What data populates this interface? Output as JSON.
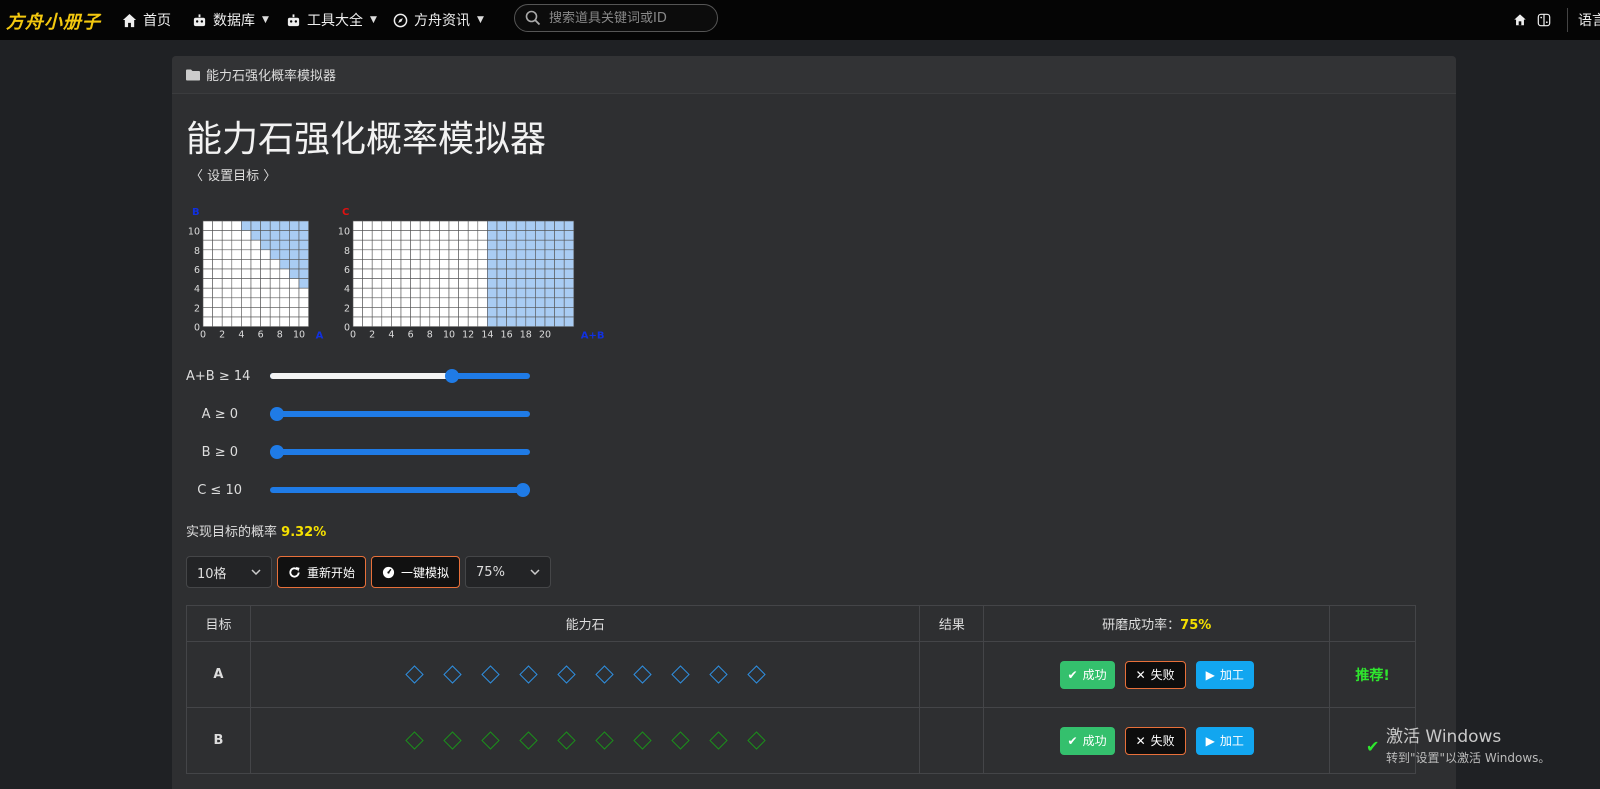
{
  "nav": {
    "logo": "方舟小册子",
    "home": "首页",
    "database": "数据库",
    "tools": "工具大全",
    "news": "方舟资讯",
    "search_placeholder": "搜索道具关键词或ID",
    "language": "语言"
  },
  "breadcrumb": "能力石强化概率模拟器",
  "title": "能力石强化概率模拟器",
  "set_goal": "〈 设置目标 〉",
  "charts": {
    "left": {
      "x_label": "A",
      "y_label": "B",
      "x_ticks": [
        "0",
        "2",
        "4",
        "6",
        "8",
        "10"
      ],
      "y_ticks": [
        "0",
        "2",
        "4",
        "6",
        "8",
        "10"
      ]
    },
    "right": {
      "x_label": "A+B",
      "y_label": "C",
      "x_ticks": [
        "0",
        "2",
        "4",
        "6",
        "8",
        "10",
        "12",
        "14",
        "16",
        "18",
        "20"
      ],
      "y_ticks": [
        "0",
        "2",
        "4",
        "6",
        "8",
        "10"
      ]
    }
  },
  "sliders": [
    {
      "label": "A+B ≥ 14",
      "value": 14,
      "min": 0,
      "max": 20
    },
    {
      "label": "A ≥ 0",
      "value": 0,
      "min": 0,
      "max": 10
    },
    {
      "label": "B ≥ 0",
      "value": 0,
      "min": 0,
      "max": 10
    },
    {
      "label": "C ≤ 10",
      "value": 10,
      "min": 0,
      "max": 10
    }
  ],
  "probability": {
    "label": "实现目标的概率",
    "value": "9.32%"
  },
  "controls": {
    "slots": "10格",
    "restart": "重新开始",
    "simulate": "一键模拟",
    "rate": "75%"
  },
  "table": {
    "headers": {
      "goal": "目标",
      "stone": "能力石",
      "result": "结果",
      "rate_label": "研磨成功率：",
      "rate_value": "75%"
    },
    "rows": [
      {
        "goal": "A",
        "success": "成功",
        "fail": "失败",
        "process": "加工",
        "recommend": "推荐!"
      },
      {
        "goal": "B",
        "success": "成功",
        "fail": "失败",
        "process": "加工",
        "recommend": ""
      }
    ]
  },
  "watermark": {
    "line1": "激活 Windows",
    "line2": "转到\"设置\"以激活 Windows。"
  },
  "colors": {
    "accent": "#1f7be6",
    "highlight": "#f5e000",
    "success": "#34c06d",
    "process": "#12a6f0",
    "recommend": "#2ee62e",
    "region": "#a9ccf3"
  }
}
